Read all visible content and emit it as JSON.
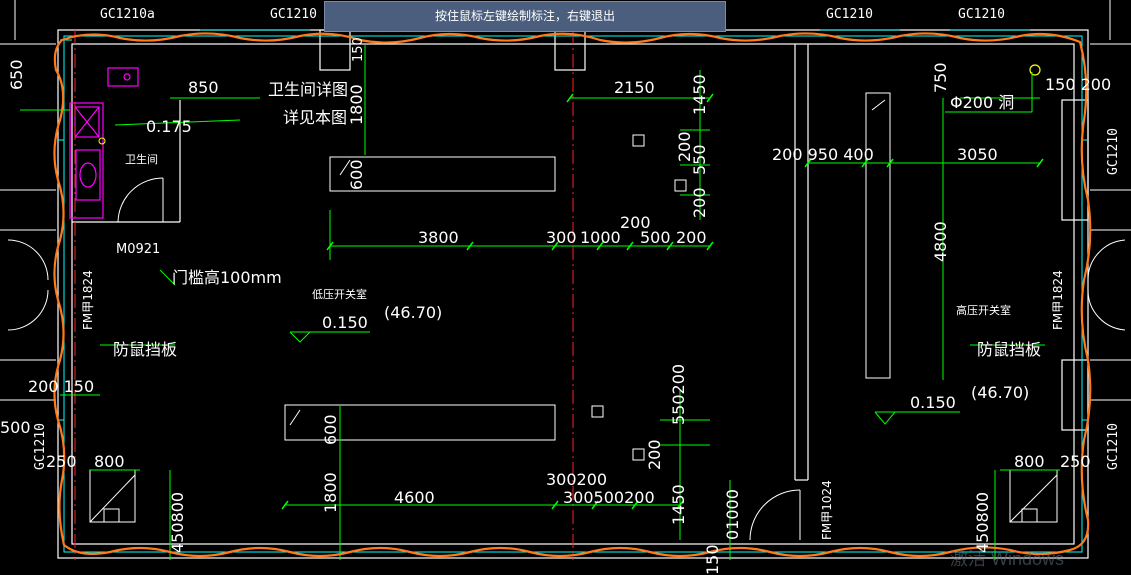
{
  "app": {
    "tooltip": "按住鼠标左键绘制标注，右键退出",
    "watermark": "激活 Windows"
  },
  "colors": {
    "background": "#000000",
    "wall": "#ffffff",
    "dimension": "#00ff00",
    "cyan": "#00ffff",
    "revision_cloud": "#ff7a1a",
    "fixture": "#ff00ff",
    "hole": "#ffff00",
    "axis": "#ff2020"
  },
  "labels": {
    "gc_tl": "GC1210a",
    "gc_t2": "GC1210",
    "gc_t3": "GC1210",
    "gc_t4": "GC1210",
    "gc_r1": "GC1210",
    "gc_r2": "GC1210",
    "gc_l": "GC1210",
    "d_150_top": "150",
    "d_650": "650",
    "d_850": "850",
    "wc_detail": "卫生间详图",
    "see_book": "详见本图",
    "elev_0175": "0.175",
    "wc_label": "卫生间",
    "d_1800_a": "1800",
    "d_600_a": "600",
    "d_2150": "2150",
    "d_1450_a": "1450",
    "d_200_a": "200",
    "d_550_a": "550",
    "d_200_b": "200",
    "d_200_c": "200",
    "d_3800": "3800",
    "d_300_a": "300",
    "d_1000_a": "1000",
    "d_500_a": "500",
    "d_200_d": "200",
    "m0921": "M0921",
    "sill": "门槛高100mm",
    "fm_left": "FM甲1824",
    "low_room": "低压开关室",
    "elev_0150_a": "0.150",
    "elev_4670_a": "(46.70)",
    "rat_left": "防鼠挡板",
    "d_200_150": "200 150",
    "d_500_l": "500",
    "d_250_a": "250",
    "d_800_a": "800",
    "d_450_800_a": "450800",
    "d_1800_b": "1800",
    "d_600_b": "600",
    "d_4600": "4600",
    "d_300200": "300200",
    "d_300500200": "300500200",
    "d_200_e": "200",
    "d_550200": "550200",
    "d_1450_b": "1450",
    "d_101000": "01000",
    "d_150_bot": "150",
    "fm_mid": "FM甲1024",
    "d_750": "750",
    "hole_label": "Φ200 洞",
    "d_150_200": "150 200",
    "d_200_950_400": "200 950 400",
    "d_3050": "3050",
    "d_4800": "4800",
    "high_room": "高压开关室",
    "fm_right": "FM甲1824",
    "rat_right": "防鼠挡板",
    "elev_4670_b": "(46.70)",
    "elev_0150_b": "0.150",
    "d_800_b": "800",
    "d_250_b": "250",
    "d_450_800_b": "450800"
  }
}
